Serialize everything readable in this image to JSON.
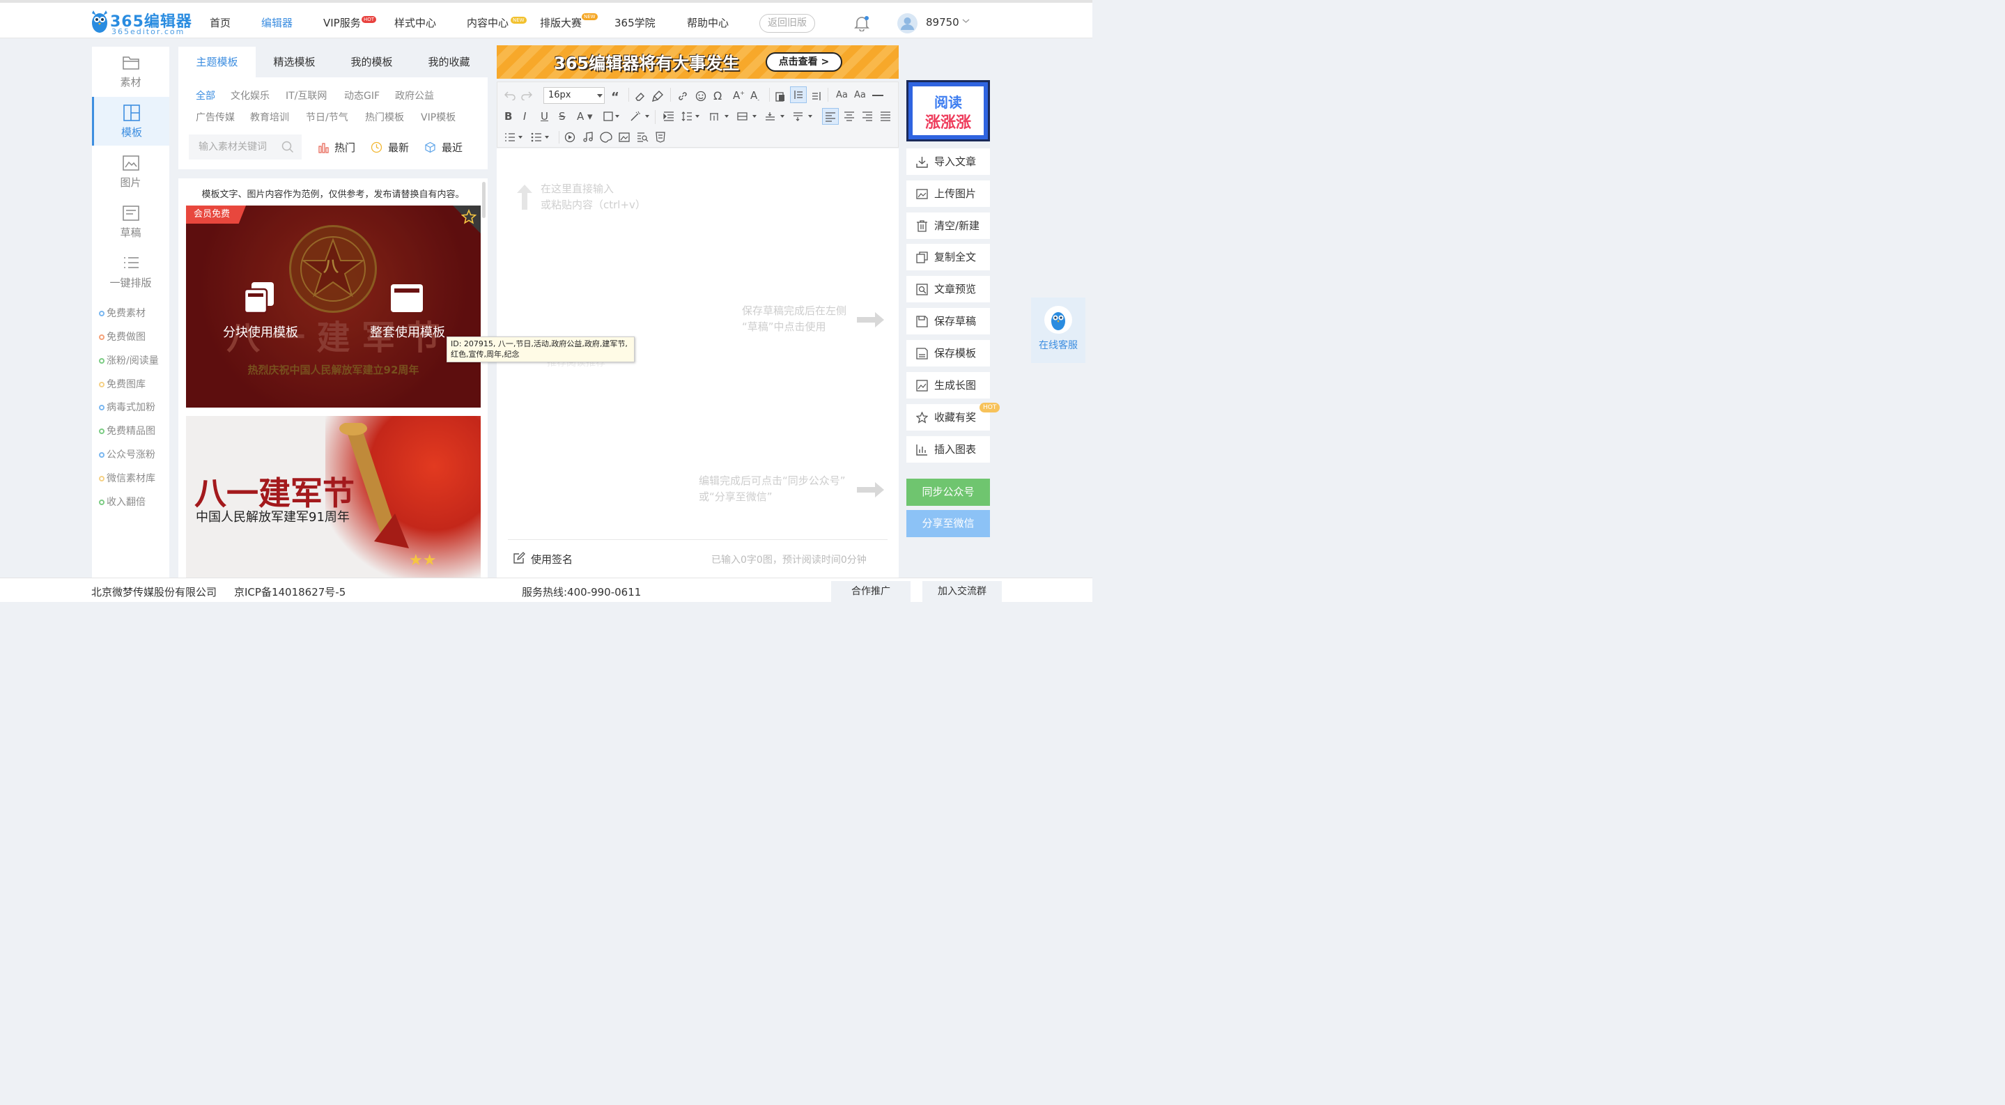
{
  "brand": {
    "name": "365编辑器",
    "domain": "365editor.com",
    "color": "#3d8ee0"
  },
  "nav": {
    "items": [
      {
        "label": "首页"
      },
      {
        "label": "编辑器",
        "active": true
      },
      {
        "label": "VIP服务",
        "badge": "HOT"
      },
      {
        "label": "样式中心"
      },
      {
        "label": "内容中心",
        "badge": "NEW"
      },
      {
        "label": "排版大赛",
        "badge": "NEW"
      },
      {
        "label": "365学院"
      },
      {
        "label": "帮助中心"
      }
    ],
    "old_version": "返回旧版",
    "user_id": "89750"
  },
  "left_sidebar": {
    "items": [
      {
        "label": "素材",
        "icon": "folder-icon"
      },
      {
        "label": "模板",
        "icon": "layout-icon",
        "active": true
      },
      {
        "label": "图片",
        "icon": "image-icon"
      },
      {
        "label": "草稿",
        "icon": "draft-icon"
      },
      {
        "label": "一键排版",
        "icon": "list-icon"
      }
    ],
    "links": [
      "免费素材",
      "免费做图",
      "涨粉/阅读量",
      "免费图库",
      "病毒式加粉",
      "免费精品图",
      "公众号涨粉",
      "微信素材库",
      "收入翻倍"
    ]
  },
  "template_panel": {
    "tabs": [
      "主题模板",
      "精选模板",
      "我的模板",
      "我的收藏"
    ],
    "categories_row1": [
      "全部",
      "文化娱乐",
      "IT/互联网",
      "动态GIF",
      "政府公益"
    ],
    "categories_row2": [
      "广告传媒",
      "教育培训",
      "节日/节气",
      "热门模板",
      "VIP模板"
    ],
    "search_placeholder": "输入素材关键词",
    "sort": [
      "热门",
      "最新",
      "最近"
    ],
    "note": "模板文字、图片内容作为范例，仅供参考，发布请替换自有内容。",
    "card1": {
      "ribbon": "会员免费",
      "big_text": "八 一 建 军 节",
      "emblem_char": "八",
      "subtitle": "热烈庆祝中国人民解放军建立92周年",
      "action_block": "分块使用模板",
      "action_full": "整套使用模板"
    },
    "card2": {
      "title": "八一建军节",
      "subtitle": "中国人民解放军建军91周年"
    },
    "tooltip": "ID: 207915, 八一,节日,活动,政府公益,政府,建军节,红色,宣传,周年,纪念"
  },
  "banner": {
    "text": "365编辑器将有大事发生",
    "button": "点击查看 >"
  },
  "toolbar": {
    "font_size": "16px"
  },
  "editor": {
    "hint_line1": "在这里直接输入",
    "hint_line2": "或粘贴内容（ctrl+v）",
    "draft_hint_1": "保存草稿完成后在左侧",
    "draft_hint_2": "“草稿”中点击使用",
    "sync_hint_1": "编辑完成后可点击“同步公众号”",
    "sync_hint_2": "或“分享至微信”",
    "behind_text": "推荐阅读推荐",
    "signature": "使用签名",
    "count": "已输入0字0图，预计阅读时间0分钟"
  },
  "right_panel": {
    "ad_line1": "阅读",
    "ad_line2": "涨涨涨",
    "buttons": [
      {
        "label": "导入文章",
        "icon": "download-icon"
      },
      {
        "label": "上传图片",
        "icon": "upload-image-icon"
      },
      {
        "label": "清空/新建",
        "icon": "trash-icon"
      },
      {
        "label": "复制全文",
        "icon": "copy-icon"
      },
      {
        "label": "文章预览",
        "icon": "preview-icon"
      },
      {
        "label": "保存草稿",
        "icon": "save-icon"
      },
      {
        "label": "保存模板",
        "icon": "save-template-icon"
      },
      {
        "label": "生成长图",
        "icon": "long-image-icon"
      },
      {
        "label": "收藏有奖",
        "icon": "star-icon",
        "badge": "HOT"
      },
      {
        "label": "插入图表",
        "icon": "chart-icon"
      }
    ],
    "sync": "同步公众号",
    "share": "分享至微信",
    "kefu": "在线客服"
  },
  "footer": {
    "company": "北京微梦传媒股份有限公司",
    "icp": "京ICP备14018627号-5",
    "hotline": "服务热线:400-990-0611",
    "promote": "合作推广",
    "group": "加入交流群"
  }
}
